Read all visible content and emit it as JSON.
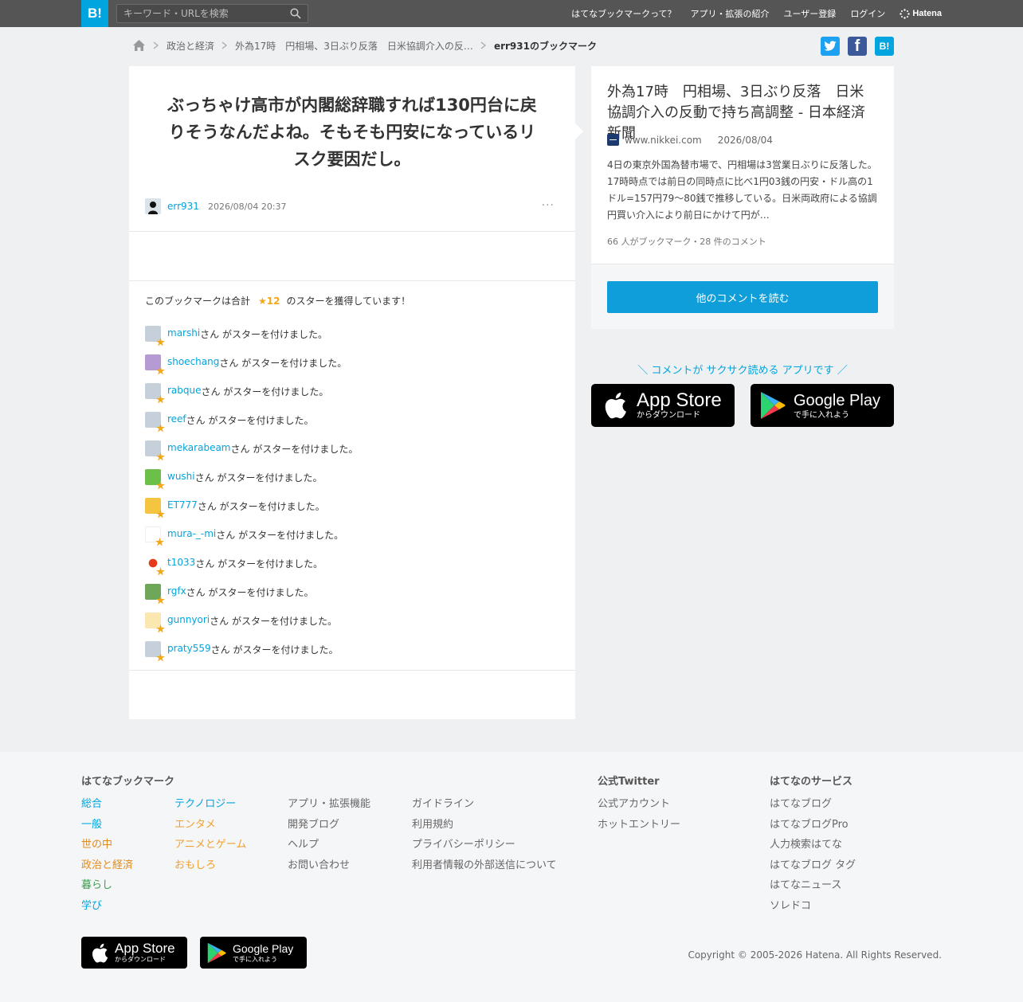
{
  "header": {
    "logo": "B!",
    "search_placeholder": "キーワード・URLを検索",
    "nav": [
      "はてなブックマークって？",
      "アプリ・拡張の紹介",
      "ユーザー登録",
      "ログイン"
    ],
    "brand": "Hatena"
  },
  "breadcrumb": {
    "items": [
      "政治と経済",
      "外為17時　円相場、3日ぶり反落　日米協調介入の反…"
    ],
    "current": "err931のブックマーク"
  },
  "share": {
    "twitter": "t",
    "facebook": "f",
    "hatena": "B!"
  },
  "bookmark": {
    "comment": "ぶっちゃけ高市が内閣総辞職すれば130円台に戻りそうなんだよね。そもそも円安になっているリスク要因だし。",
    "user": "err931",
    "date": "2026/08/04 20:37",
    "more": "···"
  },
  "stars": {
    "prefix": "このブックマークは合計",
    "count": "★12",
    "suffix": "のスターを獲得しています！",
    "suffix_text": "さん がスターを付けました。",
    "users": [
      "marshi",
      "shoechang",
      "rabque",
      "reef",
      "mekarabeam",
      "wushi",
      "ET777",
      "mura-_-mi",
      "t1033",
      "rgfx",
      "gunnyori",
      "praty559"
    ]
  },
  "entry": {
    "title": "外為17時　円相場、3日ぶり反落　日米協調介入の反動で持ち高調整 - 日本経済新聞",
    "domain": "www.nikkei.com",
    "date": "2026/08/04",
    "description": "4日の東京外国為替市場で、円相場は3営業日ぶりに反落した。17時時点では前日の同時点に比べ1円03銭の円安・ドル高の1ドル=157円79～80銭で推移している。日米両政府による協調円買い介入により前日にかけて円が…",
    "counts": "66 人がブックマーク・28 件のコメント",
    "read_button": "他のコメントを読む"
  },
  "app_promo": {
    "text": "＼ コメントが サクサク読める アプリです ／",
    "appstore_big": "App Store",
    "appstore_small": "からダウンロード",
    "googleplay_big": "Google Play",
    "googleplay_small": "で手に入れよう"
  },
  "footer": {
    "bookmark_heading": "はてなブックマーク",
    "col1": [
      "総合",
      "一般",
      "世の中",
      "政治と経済",
      "暮らし",
      "学び"
    ],
    "col2": [
      "テクノロジー",
      "エンタメ",
      "アニメとゲーム",
      "おもしろ"
    ],
    "col3": [
      "アプリ・拡張機能",
      "開発ブログ",
      "ヘルプ",
      "お問い合わせ"
    ],
    "col4": [
      "ガイドライン",
      "利用規約",
      "プライバシーポリシー",
      "利用者情報の外部送信について"
    ],
    "twitter_heading": "公式Twitter",
    "twitter_links": [
      "公式アカウント",
      "ホットエントリー"
    ],
    "services_heading": "はてなのサービス",
    "services": [
      "はてなブログ",
      "はてなブログPro",
      "人力検索はてな",
      "はてなブログ タグ",
      "はてなニュース",
      "ソレドコ"
    ],
    "copyright": "Copyright © 2005-2026 Hatena. All Rights Reserved."
  },
  "colors": {
    "brand_blue": "#00a4de",
    "header_bg": "#555555",
    "star": "#f2a818",
    "twitter": "#1da1f2",
    "facebook": "#3b5998"
  }
}
